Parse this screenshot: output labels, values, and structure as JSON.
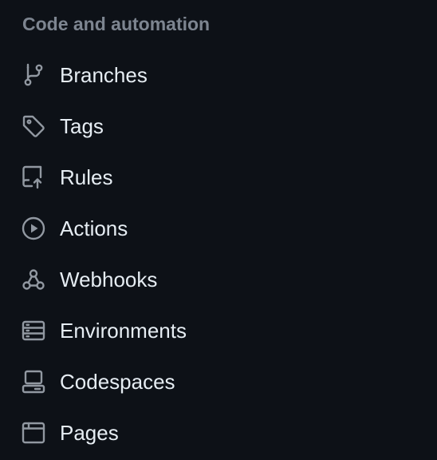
{
  "sidebar": {
    "section_title": "Code and automation",
    "items": [
      {
        "label": "Branches",
        "icon": "git-branch-icon"
      },
      {
        "label": "Tags",
        "icon": "tag-icon"
      },
      {
        "label": "Rules",
        "icon": "repo-push-icon"
      },
      {
        "label": "Actions",
        "icon": "play-icon"
      },
      {
        "label": "Webhooks",
        "icon": "webhook-icon"
      },
      {
        "label": "Environments",
        "icon": "server-icon"
      },
      {
        "label": "Codespaces",
        "icon": "codespaces-icon"
      },
      {
        "label": "Pages",
        "icon": "browser-icon"
      }
    ]
  },
  "colors": {
    "background": "#0d1117",
    "heading": "#7d8590",
    "text": "#e6edf3",
    "icon": "#9198a1"
  }
}
